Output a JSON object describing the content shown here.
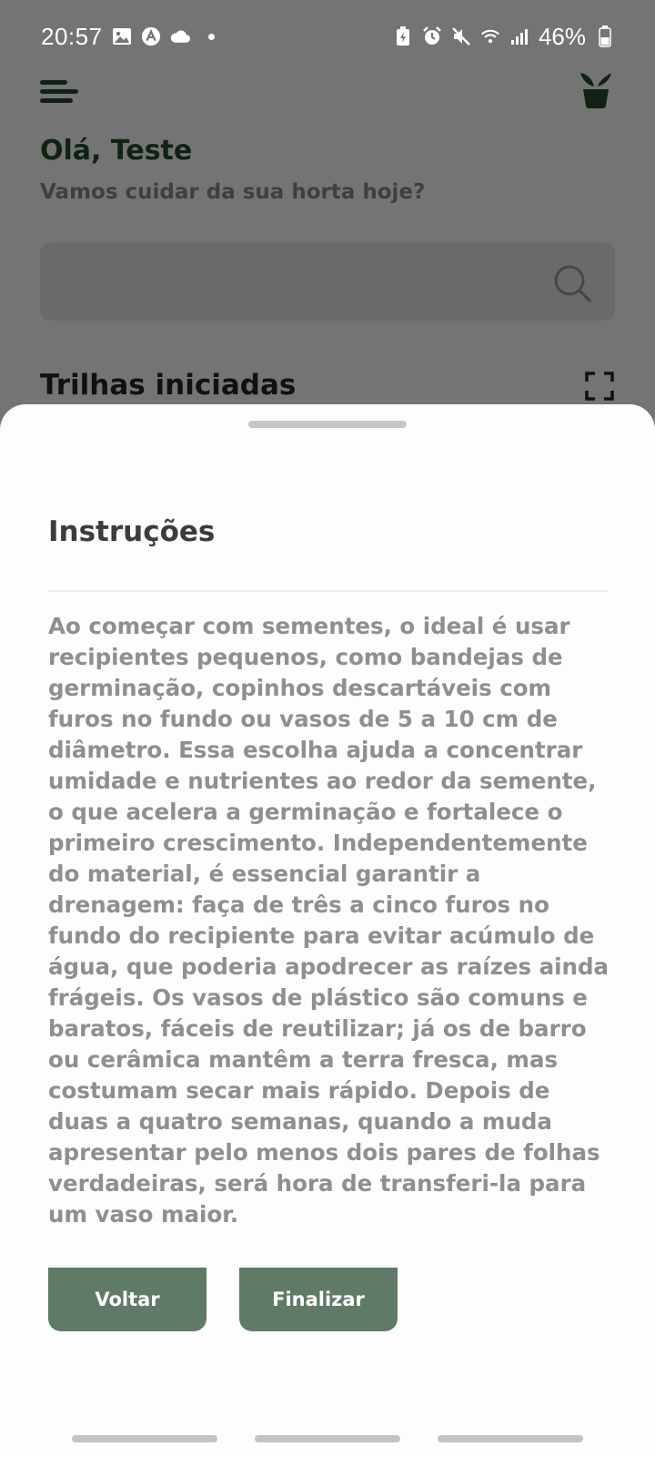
{
  "status_bar": {
    "time": "20:57",
    "battery": "46%",
    "left_icons": [
      "gallery-icon",
      "app-icon",
      "cloud-icon",
      "notification-dot"
    ],
    "right_icons": [
      "battery-saver-icon",
      "alarm-icon",
      "mute-icon",
      "wifi-icon",
      "signal-icon",
      "battery-icon"
    ]
  },
  "header": {
    "menu_icon": "menu-icon",
    "logo_icon": "plant-icon",
    "greeting": "Olá, Teste",
    "subtitle": "Vamos cuidar da sua horta hoje?"
  },
  "search": {
    "placeholder": "",
    "icon": "search-icon"
  },
  "section": {
    "title": "Trilhas iniciadas",
    "expand_icon": "expand-icon"
  },
  "sheet": {
    "title": "Instruções",
    "body": "Ao começar com sementes, o ideal é usar recipientes pequenos, como bandejas de germinação, copinhos descartáveis com furos no fundo ou vasos de 5 a 10 cm de diâmetro. Essa escolha ajuda a concentrar umidade e nutrientes ao redor da semente, o que acelera a germinação e fortalece o primeiro crescimento. Independentemente do material, é essencial garantir a drenagem: faça de três a cinco furos no fundo do recipiente para evitar acúmulo de água, que poderia apodrecer as raízes ainda frágeis. Os vasos de plástico são comuns e baratos, fáceis de reutilizar; já os de barro ou cerâmica mantêm a terra fresca, mas costumam secar mais rápido. Depois de duas a quatro semanas, quando a muda apresentar pelo menos dois pares de folhas verdadeiras, será hora de transferi-la para um vaso maior.",
    "back_label": "Voltar",
    "finish_label": "Finalizar"
  },
  "colors": {
    "overlay": "#747474",
    "accent": "#5f7a66",
    "greeting": "#102213",
    "body_text": "#8f8f8f"
  }
}
